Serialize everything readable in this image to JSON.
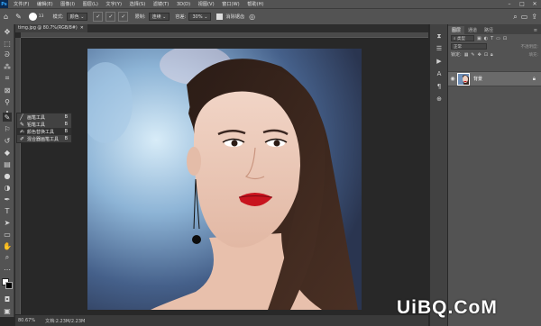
{
  "app": {
    "logo": "Ps"
  },
  "menu": [
    "文件(F)",
    "编辑(E)",
    "图像(I)",
    "图层(L)",
    "文字(Y)",
    "选择(S)",
    "滤镜(T)",
    "3D(D)",
    "视图(V)",
    "窗口(W)",
    "帮助(H)"
  ],
  "window_controls": [
    "–",
    "□",
    "✕"
  ],
  "options": {
    "brush_size": "13",
    "mode_label": "模式:",
    "mode_value": "颜色",
    "limit_label": "限制:",
    "limit_value": "连续",
    "tolerance_label": "容差:",
    "tolerance_value": "30%",
    "antialias_label": "消除锯齿"
  },
  "document": {
    "tab_title": "timg.jpg @ 80.7%(RGB/8#)"
  },
  "flyout": [
    {
      "icon": "brush-icon",
      "label": "画笔工具",
      "key": "B"
    },
    {
      "icon": "pencil-icon",
      "label": "铅笔工具",
      "key": "B"
    },
    {
      "icon": "color-replace-icon",
      "label": "颜色替换工具",
      "key": "B"
    },
    {
      "icon": "mixer-brush-icon",
      "label": "混合器画笔工具",
      "key": "B"
    }
  ],
  "status": {
    "zoom": "80.67%",
    "doc_info": "文档:2.23M/2.23M"
  },
  "layers_panel": {
    "tabs": [
      "图层",
      "通道",
      "路径"
    ],
    "search_placeholder": "类型",
    "blend_mode": "正常",
    "opacity_label": "不透明度:",
    "fill_label": "填充:",
    "lock_label": "锁定:",
    "layer_name": "背景"
  },
  "watermark": "UiBQ.CoM"
}
